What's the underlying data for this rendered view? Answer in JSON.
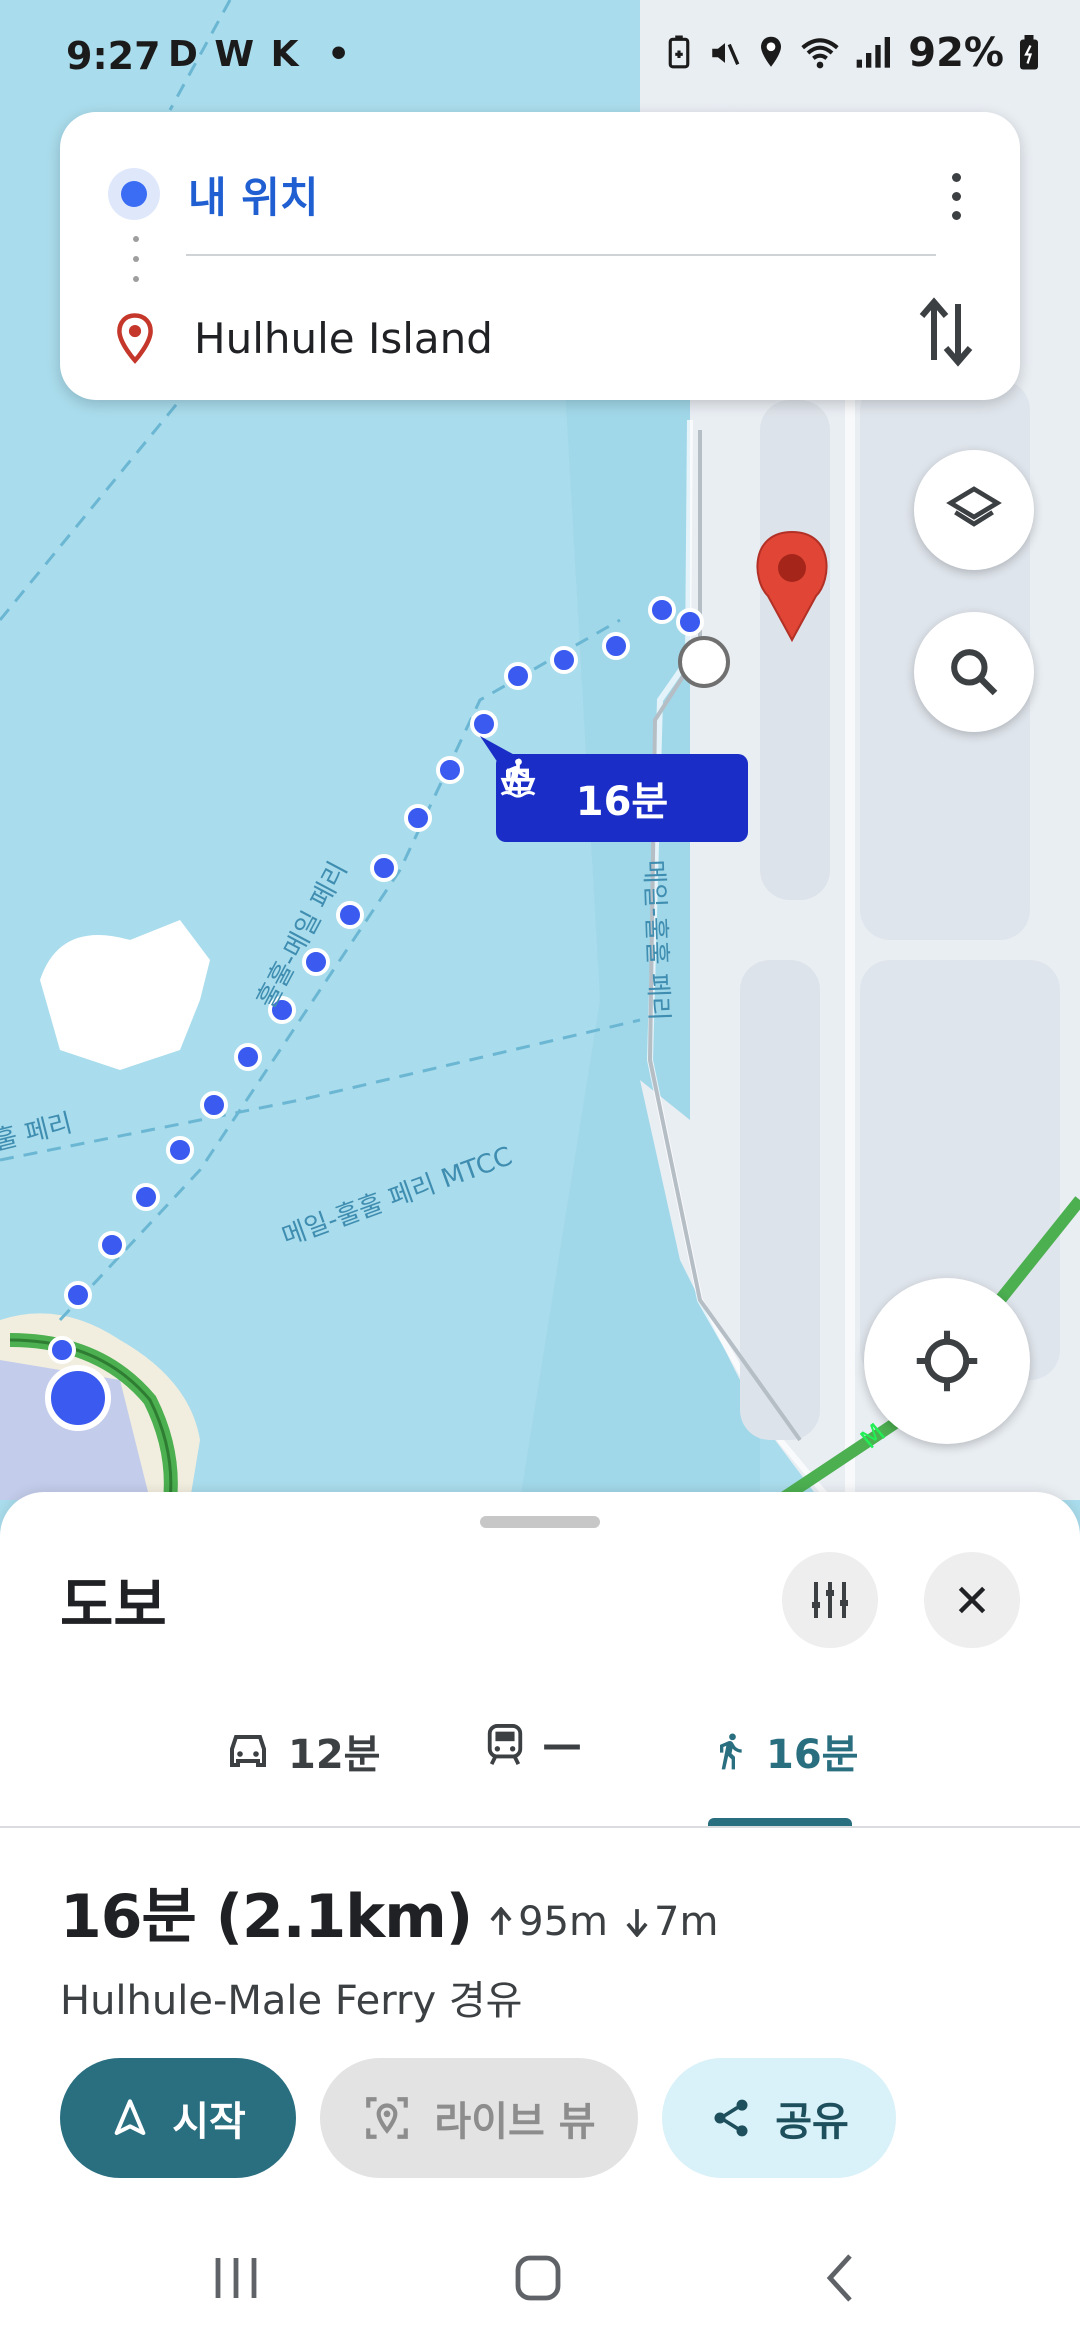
{
  "status_bar": {
    "time": "9:27",
    "left_icons": "D W K",
    "dot": "•",
    "battery_percent": "92%",
    "icons": [
      "battery-saver-icon",
      "mute-icon",
      "location-icon",
      "wifi-icon",
      "signal-icon",
      "battery-icon"
    ]
  },
  "search_card": {
    "from_label": "내 위치",
    "to_label": "Hulhule Island",
    "icons": [
      "origin-dot-icon",
      "destination-pin-icon",
      "more-vert-icon",
      "swap-icon"
    ]
  },
  "map": {
    "route_label": {
      "time": "16분",
      "icons": [
        "walk-icon",
        "ferry-icon"
      ]
    },
    "labels": [
      {
        "text": "훌훌-메일 페리"
      },
      {
        "text": "메일-훌훌 페리 MTCC"
      },
      {
        "text": "메일-훌훌 페리"
      },
      {
        "text": "훌 페리"
      },
      {
        "text": "M"
      }
    ],
    "colors": {
      "water": "#a9dcec",
      "land": "#e9eef3",
      "route": "#3a5af0",
      "traffic": "#4caf50",
      "pin": "#e04535"
    }
  },
  "floating_buttons": [
    "layers-icon",
    "search-icon",
    "my-location-icon"
  ],
  "sheet": {
    "title": "도보",
    "tabs": [
      {
        "mode": "car",
        "label": "12분",
        "icon": "car-icon"
      },
      {
        "mode": "transit",
        "label": "—",
        "icon": "train-icon"
      },
      {
        "mode": "walk",
        "label": "16분",
        "icon": "walk-icon",
        "active": true
      }
    ],
    "summary": {
      "duration": "16분 (2.1km)",
      "ascent": "95m",
      "descent": "7m"
    },
    "via": "Hulhule-Male Ferry 경유",
    "actions": {
      "start": "시작",
      "live_view": "라이브 뷰",
      "share": "공유"
    },
    "colors": {
      "accent": "#2a6f80",
      "share_bg": "#d9f1f8"
    }
  },
  "nav_bar": {
    "icons": [
      "recents-icon",
      "home-icon",
      "back-icon"
    ]
  }
}
